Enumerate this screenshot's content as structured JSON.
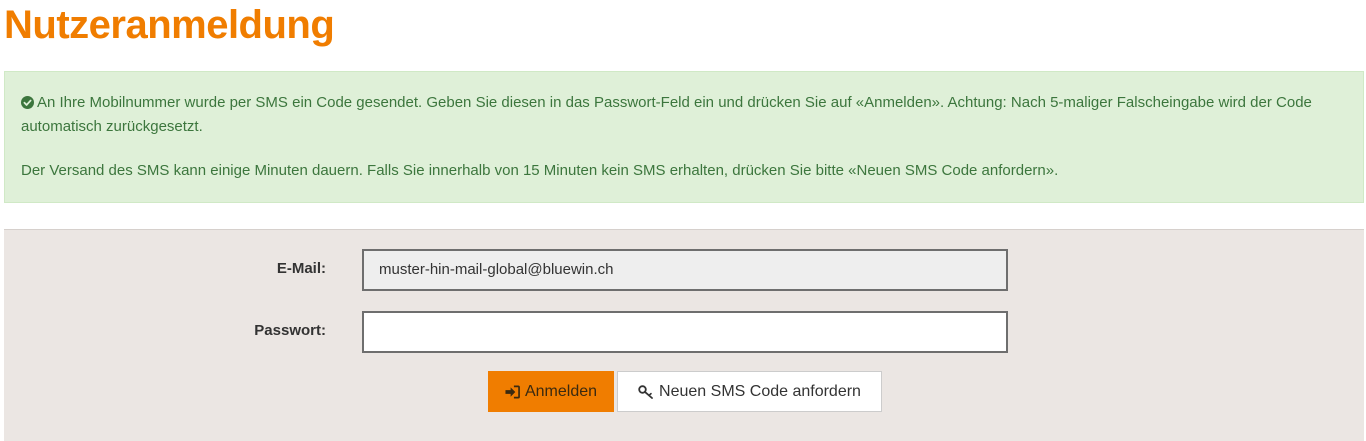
{
  "page": {
    "title": "Nutzeranmeldung"
  },
  "alert": {
    "icon": "check-circle-icon",
    "message_1": "An Ihre Mobilnummer wurde per SMS ein Code gesendet. Geben Sie diesen in das Passwort-Feld ein und drücken Sie auf «Anmelden». Achtung: Nach 5-maliger Falscheingabe wird der Code automatisch zurückgesetzt.",
    "message_2": "Der Versand des SMS kann einige Minuten dauern. Falls Sie innerhalb von 15 Minuten kein SMS erhalten, drücken Sie bitte «Neuen SMS Code anfordern»."
  },
  "form": {
    "email_label": "E-Mail:",
    "email_value": "muster-hin-mail-global@bluewin.ch",
    "password_label": "Passwort:",
    "password_value": "",
    "login_button": {
      "label": "Anmelden",
      "icon": "sign-in-icon"
    },
    "sms_button": {
      "label": "Neuen SMS Code anfordern",
      "icon": "key-icon"
    }
  },
  "colors": {
    "brand_orange": "#f07d00",
    "alert_bg": "#dff0d8",
    "alert_text": "#3c763d",
    "panel_bg": "#ebe6e3"
  }
}
